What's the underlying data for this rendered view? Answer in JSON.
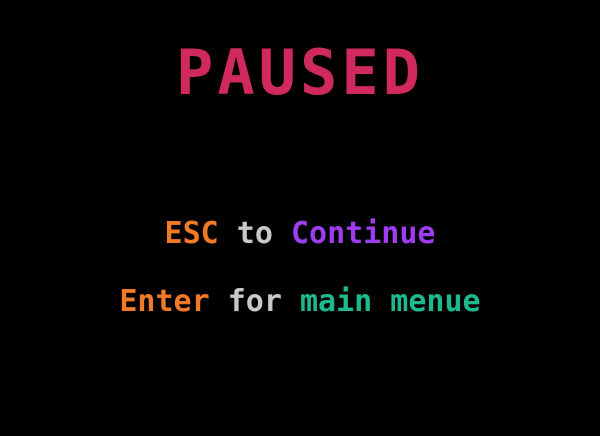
{
  "pause_screen": {
    "title": "PAUSED",
    "continue_line": {
      "key": "ESC",
      "connector": "to",
      "action": "Continue"
    },
    "menu_line": {
      "key": "Enter",
      "connector": "for",
      "action": "main menue"
    }
  },
  "colors": {
    "background": "#000000",
    "title": "#d02a5c",
    "key": "#f07a26",
    "connector": "#c8c8c8",
    "continue_action": "#9e3cf0",
    "menu_action": "#1fb98e"
  }
}
